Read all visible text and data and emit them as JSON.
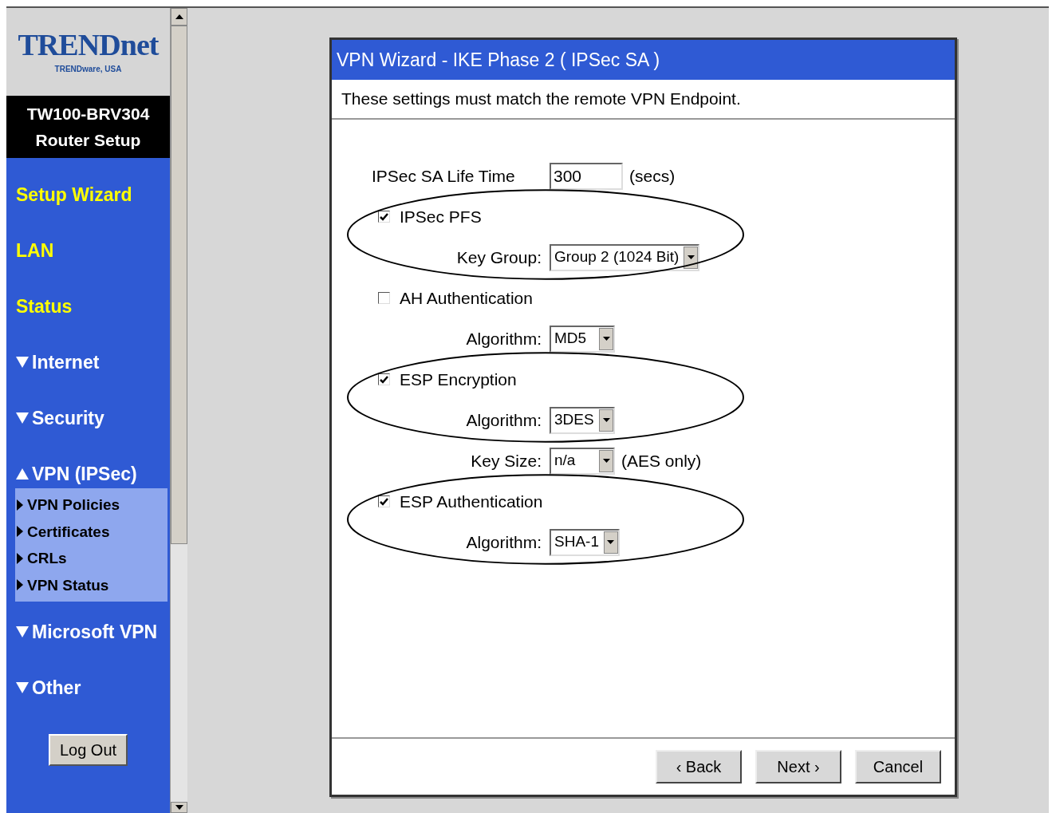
{
  "sidebar": {
    "brand": "TRENDnet",
    "brand_subtitle": "TRENDware, USA",
    "model": "TW100-BRV304",
    "subtitle": "Router Setup",
    "items": [
      {
        "label": "Setup Wizard",
        "kind": "link"
      },
      {
        "label": "LAN",
        "kind": "link"
      },
      {
        "label": "Status",
        "kind": "link"
      },
      {
        "label": "Internet",
        "kind": "section",
        "expanded": false
      },
      {
        "label": "Security",
        "kind": "section",
        "expanded": false
      },
      {
        "label": "VPN (IPSec)",
        "kind": "section",
        "expanded": true,
        "children": [
          {
            "label": "VPN Policies"
          },
          {
            "label": "Certificates"
          },
          {
            "label": "CRLs"
          },
          {
            "label": "VPN Status"
          }
        ]
      },
      {
        "label": "Microsoft VPN",
        "kind": "section",
        "expanded": false
      },
      {
        "label": "Other",
        "kind": "section",
        "expanded": false
      }
    ],
    "logout": "Log Out"
  },
  "dialog": {
    "title": "VPN Wizard - IKE Phase 2 ( IPSec SA )",
    "description": "These settings must match the remote VPN Endpoint.",
    "groups": [
      {
        "circled": false,
        "rows": [
          {
            "kind": "text-field",
            "label": "IPSec SA Life Time",
            "value": "300",
            "suffix": "(secs)"
          }
        ]
      },
      {
        "circled": true,
        "rows": [
          {
            "kind": "checkbox",
            "label": "IPSec PFS",
            "checked": true
          },
          {
            "kind": "select",
            "label": "Key Group:",
            "value": "Group 2 (1024 Bit)"
          }
        ]
      },
      {
        "circled": false,
        "rows": [
          {
            "kind": "checkbox",
            "label": "AH Authentication",
            "checked": false
          },
          {
            "kind": "select",
            "label": "Algorithm:",
            "value": "MD5"
          }
        ]
      },
      {
        "circled": true,
        "rows": [
          {
            "kind": "checkbox",
            "label": "ESP Encryption",
            "checked": true
          },
          {
            "kind": "select",
            "label": "Algorithm:",
            "value": "3DES"
          }
        ]
      },
      {
        "circled": false,
        "rows": [
          {
            "kind": "select",
            "label": "Key Size:",
            "value": "n/a",
            "suffix": "(AES only)"
          }
        ]
      },
      {
        "circled": true,
        "rows": [
          {
            "kind": "checkbox",
            "label": "ESP Authentication",
            "checked": true
          },
          {
            "kind": "select",
            "label": "Algorithm:",
            "value": "SHA-1"
          }
        ]
      }
    ],
    "buttons": [
      "‹ Back",
      "Next ›",
      "Cancel"
    ]
  }
}
